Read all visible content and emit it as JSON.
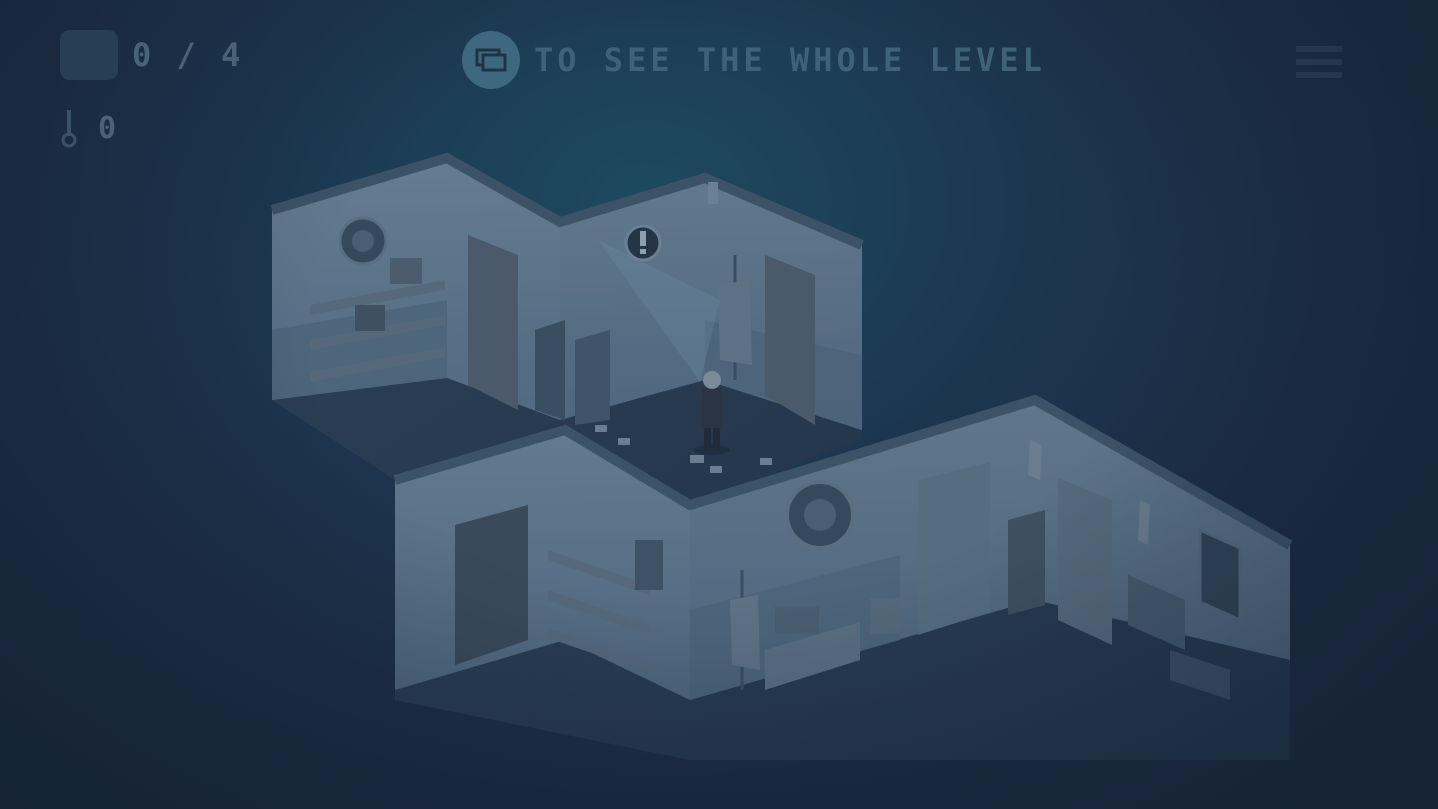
{
  "hud": {
    "evidence": {
      "icon": "evidence-folder-icon",
      "count_text": "0 / 4"
    },
    "keys": {
      "icon": "key-icon",
      "count_text": "0"
    },
    "hint": {
      "icon": "overview-cards-icon",
      "text": "TO SEE THE WHOLE LEVEL"
    },
    "menu": {
      "icon": "menu-icon"
    }
  },
  "scene": {
    "alert_icon": "exclamation-alert-icon",
    "objects": [
      "fbi-seal-upper",
      "fbi-seal-lower",
      "us-flag-upper",
      "us-flag-lower",
      "bookshelf-upper",
      "bookshelf-lower",
      "desk",
      "chair",
      "window",
      "agent-character",
      "security-camera"
    ]
  },
  "colors": {
    "background": "#1b2a3f",
    "hud_text": "#4a6277",
    "hint_button": "#3d6880",
    "wall_light": "#6a8296",
    "wall_shadow": "#4a6276",
    "floor": "#2c3e52"
  }
}
